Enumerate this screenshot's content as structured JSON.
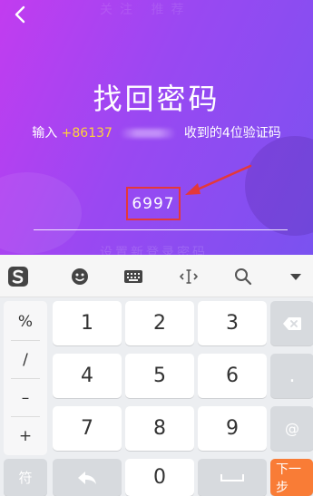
{
  "screen": {
    "title": "找回密码",
    "subtitle_prefix": "输入",
    "phone_visible": "+86137",
    "subtitle_suffix": "收到的4位验证码",
    "code_value": "6997"
  },
  "header": {
    "back_icon": "chevron-left-icon"
  },
  "background_text": {
    "top": "关注 推荐",
    "bottom": "设置新登录密码"
  },
  "keyboard": {
    "toolbar_icons": [
      "sogou-logo-icon",
      "emoji-icon",
      "keyboard-icon",
      "cursor-move-icon",
      "search-icon",
      "chevron-down-icon"
    ],
    "symbols": [
      "%",
      "/",
      "–",
      "+"
    ],
    "keys": {
      "k1": "1",
      "k2": "2",
      "k3": "3",
      "k4": "4",
      "k5": "5",
      "k6": "6",
      "k7": "7",
      "k8": "8",
      "k9": "9",
      "k0": "0"
    },
    "side_keys": {
      "dot": ".",
      "at": "@"
    },
    "bottom": {
      "symbols_label": "符",
      "next_label": "下一步"
    }
  },
  "colors": {
    "accent_purple": "#9a48f2",
    "phone_highlight": "#ffd23a",
    "highlight_box": "#e4383a",
    "next_button": "#f97c36"
  }
}
